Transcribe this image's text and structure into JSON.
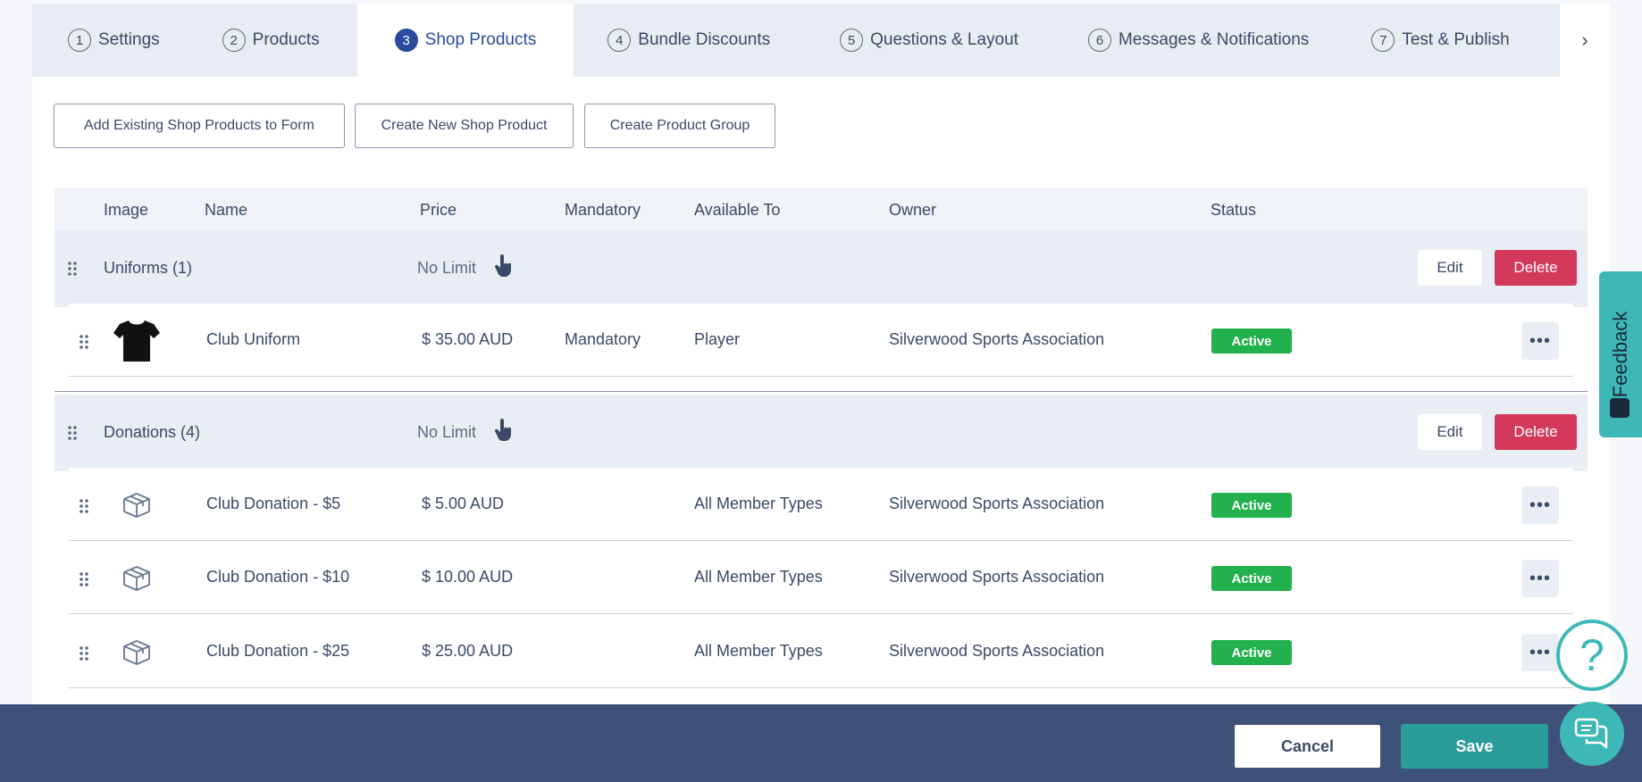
{
  "tabs": [
    {
      "num": "1",
      "label": "Settings"
    },
    {
      "num": "2",
      "label": "Products"
    },
    {
      "num": "3",
      "label": "Shop Products"
    },
    {
      "num": "4",
      "label": "Bundle Discounts"
    },
    {
      "num": "5",
      "label": "Questions & Layout"
    },
    {
      "num": "6",
      "label": "Messages & Notifications"
    },
    {
      "num": "7",
      "label": "Test & Publish"
    }
  ],
  "tab_next_icon": "›",
  "actions": {
    "add_existing": "Add Existing Shop Products to Form",
    "create_new": "Create New Shop Product",
    "create_group": "Create Product Group"
  },
  "columns": {
    "image": "Image",
    "name": "Name",
    "price": "Price",
    "mandatory": "Mandatory",
    "available_to": "Available To",
    "owner": "Owner",
    "status": "Status"
  },
  "groups": [
    {
      "name": "Uniforms (1)",
      "limit": "No Limit",
      "edit": "Edit",
      "delete": "Delete",
      "products": [
        {
          "name": "Club Uniform",
          "price": "$ 35.00 AUD",
          "mandatory": "Mandatory",
          "available_to": "Player",
          "owner": "Silverwood Sports Association",
          "status": "Active",
          "image": "tshirt-icon"
        }
      ]
    },
    {
      "name": "Donations (4)",
      "limit": "No Limit",
      "edit": "Edit",
      "delete": "Delete",
      "products": [
        {
          "name": "Club Donation - $5",
          "price": "$ 5.00 AUD",
          "mandatory": "",
          "available_to": "All Member Types",
          "owner": "Silverwood Sports Association",
          "status": "Active",
          "image": "box-icon"
        },
        {
          "name": "Club Donation - $10",
          "price": "$ 10.00 AUD",
          "mandatory": "",
          "available_to": "All Member Types",
          "owner": "Silverwood Sports Association",
          "status": "Active",
          "image": "box-icon"
        },
        {
          "name": "Club Donation - $25",
          "price": "$ 25.00 AUD",
          "mandatory": "",
          "available_to": "All Member Types",
          "owner": "Silverwood Sports Association",
          "status": "Active",
          "image": "box-icon"
        }
      ]
    }
  ],
  "more_icon": "•••",
  "footer": {
    "cancel": "Cancel",
    "save": "Save"
  },
  "feedback": "Feedback",
  "help_icon": "?",
  "colors": {
    "accent": "#2a4a9e",
    "delete": "#d2395a",
    "active": "#22b14c",
    "save": "#2a9d9b",
    "footer": "#3e5178",
    "teal": "#3eb8b6"
  }
}
